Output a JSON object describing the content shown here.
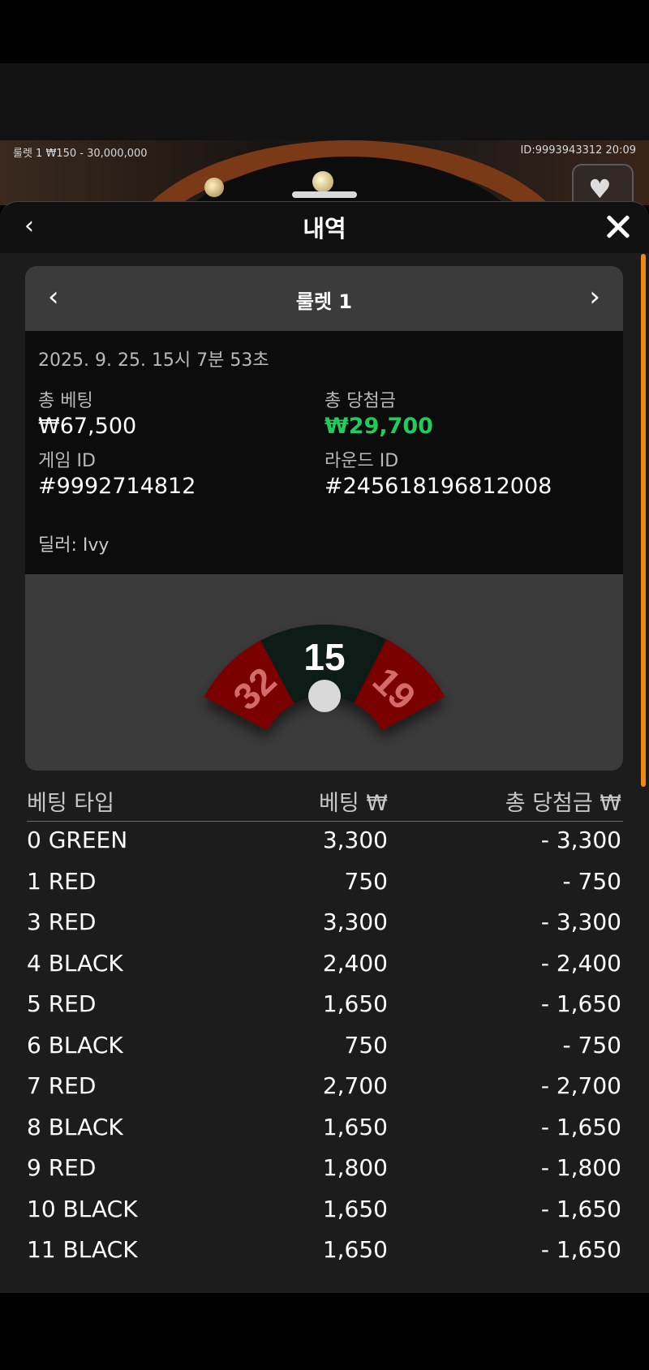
{
  "video": {
    "left_label": "룰렛 1  ₩150 - 30,000,000",
    "right_label": "ID:9993943312  20:09"
  },
  "sheet": {
    "title": "내역",
    "back_icon": "‹",
    "close_icon": "close-icon"
  },
  "card": {
    "title": "룰렛 1",
    "prev_icon": "‹",
    "next_icon": "›",
    "datetime": "2025. 9. 25. 15시 7분 53초",
    "total_bet_label": "총 베팅",
    "total_bet_value": "₩67,500",
    "total_win_label": "총 당첨금",
    "total_win_value": "₩29,700",
    "game_id_label": "게임 ID",
    "game_id_value": "#9992714812",
    "round_id_label": "라운드 ID",
    "round_id_value": "#245618196812008",
    "dealer": "딜러: Ivy"
  },
  "result": {
    "left_number": "32",
    "center_number": "15",
    "right_number": "19",
    "colors": {
      "red": "#7a0000",
      "green": "#0b1a17",
      "ball": "#d9d9d9"
    }
  },
  "table": {
    "headers": [
      "베팅 타입",
      "베팅 ₩",
      "총 당첨금 ₩"
    ],
    "rows": [
      [
        "0 GREEN",
        "3,300",
        "- 3,300"
      ],
      [
        "1 RED",
        "750",
        "- 750"
      ],
      [
        "3 RED",
        "3,300",
        "- 3,300"
      ],
      [
        "4 BLACK",
        "2,400",
        "- 2,400"
      ],
      [
        "5 RED",
        "1,650",
        "- 1,650"
      ],
      [
        "6 BLACK",
        "750",
        "- 750"
      ],
      [
        "7 RED",
        "2,700",
        "- 2,700"
      ],
      [
        "8 BLACK",
        "1,650",
        "- 1,650"
      ],
      [
        "9 RED",
        "1,800",
        "- 1,800"
      ],
      [
        "10 BLACK",
        "1,650",
        "- 1,650"
      ],
      [
        "11 BLACK",
        "1,650",
        "- 1,650"
      ]
    ]
  }
}
